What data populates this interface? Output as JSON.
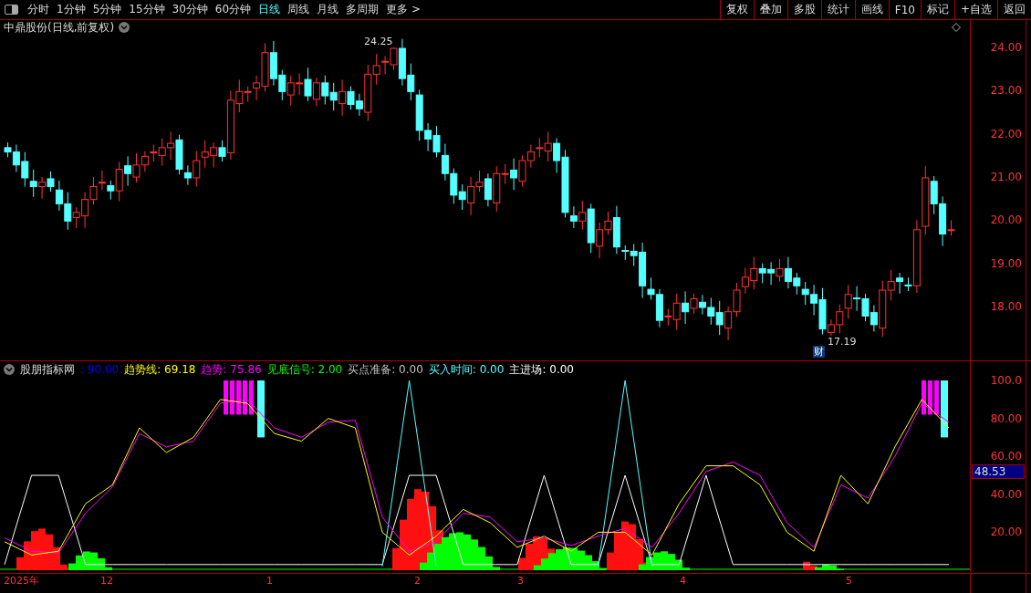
{
  "toolbar": {
    "periods": [
      {
        "label": "分时",
        "selected": false
      },
      {
        "label": "1分钟",
        "selected": false
      },
      {
        "label": "5分钟",
        "selected": false
      },
      {
        "label": "15分钟",
        "selected": false
      },
      {
        "label": "30分钟",
        "selected": false
      },
      {
        "label": "60分钟",
        "selected": false
      },
      {
        "label": "日线",
        "selected": true
      },
      {
        "label": "周线",
        "selected": false
      },
      {
        "label": "月线",
        "selected": false
      },
      {
        "label": "多周期",
        "selected": false
      },
      {
        "label": "更多 >",
        "selected": false
      }
    ],
    "actions": [
      "复权",
      "叠加",
      "多股",
      "统计",
      "画线",
      "F10",
      "标记",
      "+自选",
      "返回"
    ]
  },
  "price_chart": {
    "title": "中鼎股份(日线,前复权)",
    "high_label": "24.25",
    "low_label": "17.19",
    "badge": "财",
    "yticks": [
      "24.00",
      "23.00",
      "22.00",
      "21.00",
      "20.00",
      "19.00",
      "18.00"
    ]
  },
  "indicator": {
    "name": "股朋指标网",
    "values": [
      {
        "text": ": 90.00",
        "color": "#0000ff"
      },
      {
        "text": "趋势线: 69.18",
        "color": "#ffff00"
      },
      {
        "text": "趋势: 75.86",
        "color": "#ff00ff"
      },
      {
        "text": "见底信号: 2.00",
        "color": "#00ff00"
      },
      {
        "text": "买点准备: 0.00",
        "color": "#c0c0c0"
      },
      {
        "text": "买入时间: 0.00",
        "color": "#54ffff"
      },
      {
        "text": "主进场: 0.00",
        "color": "#ffffff"
      }
    ],
    "chart_data": {
      "type": "line",
      "ylim": [
        0,
        100
      ],
      "yticks": [
        {
          "value": 100,
          "label": "100.0"
        },
        {
          "value": 80,
          "label": "80.00"
        },
        {
          "value": 60,
          "label": "60.00"
        },
        {
          "value": 40,
          "label": "40.00"
        },
        {
          "value": 20,
          "label": "20.00"
        }
      ],
      "series": [
        {
          "color": "#ffffff",
          "values": [
            3,
            50,
            50,
            3,
            3,
            3,
            3,
            3,
            3,
            3,
            3,
            3,
            3,
            3,
            3,
            50,
            50,
            3,
            3,
            3,
            50,
            3,
            3,
            50,
            3,
            3,
            50,
            3,
            3,
            3,
            3,
            3,
            3,
            3,
            3,
            3
          ]
        },
        {
          "color": "#54ffff",
          "values": [
            null,
            null,
            null,
            null,
            null,
            null,
            null,
            null,
            null,
            null,
            null,
            null,
            null,
            null,
            2,
            100,
            2,
            null,
            null,
            null,
            null,
            null,
            2,
            100,
            2,
            null,
            null,
            null,
            null,
            null,
            null,
            null,
            null,
            null,
            null,
            null
          ]
        },
        {
          "color": "#ff00ff",
          "values": [
            17,
            10,
            9,
            30,
            44,
            72,
            65,
            68,
            88,
            90,
            75,
            70,
            78,
            79,
            28,
            10,
            15,
            30,
            28,
            15,
            17,
            13,
            18,
            22,
            12,
            30,
            52,
            57,
            50,
            25,
            12,
            45,
            38,
            60,
            88,
            78
          ]
        },
        {
          "color": "#ffff00",
          "values": [
            15,
            8,
            10,
            35,
            45,
            75,
            62,
            70,
            90,
            88,
            72,
            68,
            80,
            75,
            20,
            8,
            18,
            32,
            25,
            12,
            18,
            10,
            20,
            20,
            8,
            35,
            55,
            55,
            45,
            20,
            10,
            50,
            35,
            65,
            90,
            75
          ]
        }
      ]
    },
    "current": "48.53"
  },
  "date_axis": [
    "2025年",
    "12",
    "1",
    "2",
    "3",
    "4",
    "5"
  ]
}
